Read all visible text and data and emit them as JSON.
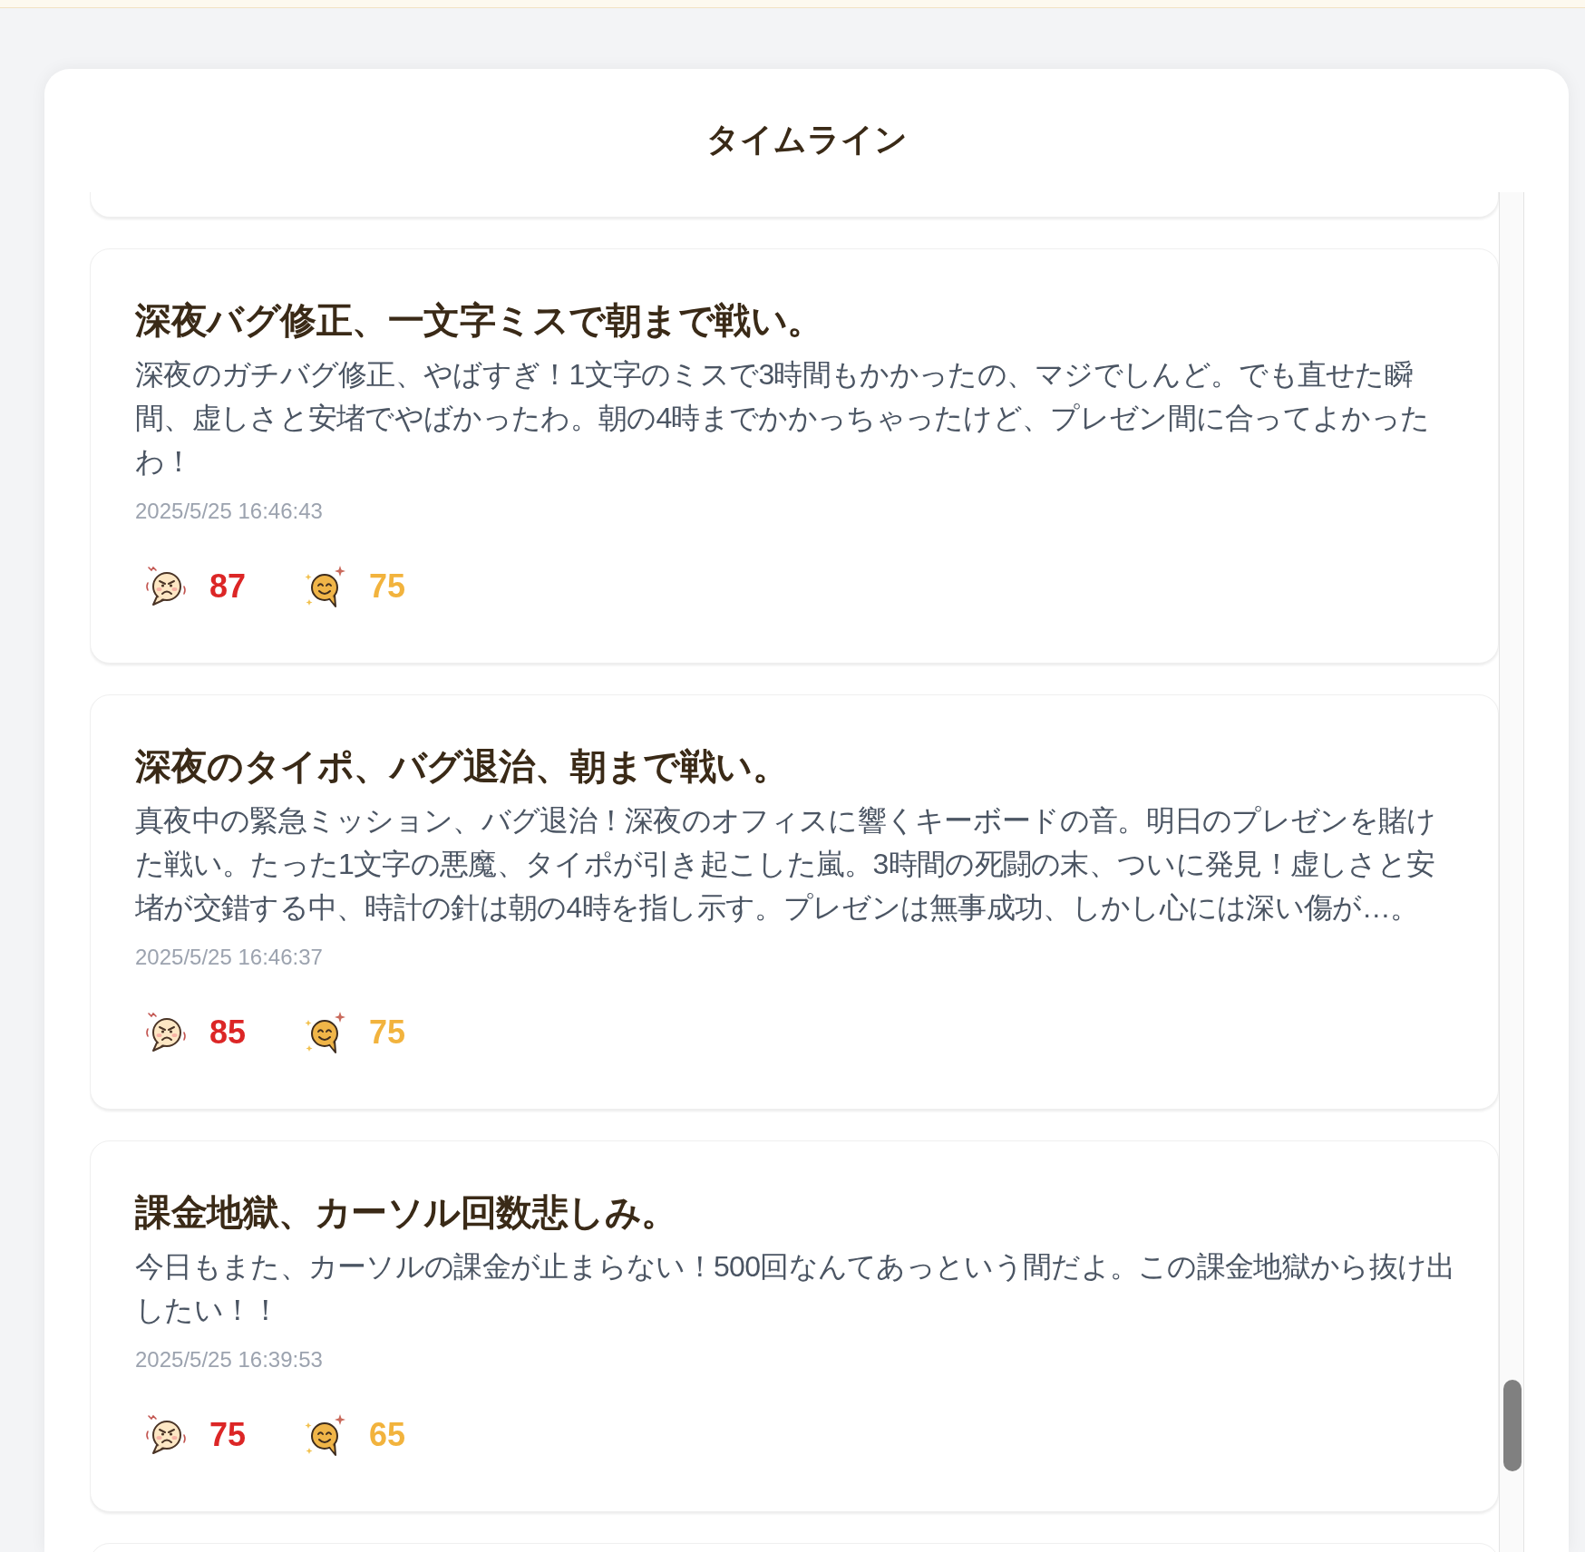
{
  "header": {
    "title": "タイムライン"
  },
  "posts": [
    {
      "title": "深夜バグ修正、一文字ミスで朝まで戦い。",
      "body": "深夜のガチバグ修正、やばすぎ！1文字のミスで3時間もかかったの、マジでしんど。でも直せた瞬間、虚しさと安堵でやばかったわ。朝の4時までかかっちゃったけど、プレゼン間に合ってよかったわ！",
      "timestamp": "2025/5/25 16:46:43",
      "reactions": [
        {
          "kind": "angry",
          "count": "87"
        },
        {
          "kind": "smile",
          "count": "75"
        }
      ]
    },
    {
      "title": "深夜のタイポ、バグ退治、朝まで戦い。",
      "body": "真夜中の緊急ミッション、バグ退治！深夜のオフィスに響くキーボードの音。明日のプレゼンを賭けた戦い。たった1文字の悪魔、タイポが引き起こした嵐。3時間の死闘の末、ついに発見！虚しさと安堵が交錯する中、時計の針は朝の4時を指し示す。プレゼンは無事成功、しかし心には深い傷が…。",
      "timestamp": "2025/5/25 16:46:37",
      "reactions": [
        {
          "kind": "angry",
          "count": "85"
        },
        {
          "kind": "smile",
          "count": "75"
        }
      ]
    },
    {
      "title": "課金地獄、カーソル回数悲しみ。",
      "body": "今日もまた、カーソルの課金が止まらない！500回なんてあっという間だよ。この課金地獄から抜け出したい！！",
      "timestamp": "2025/5/25 16:39:53",
      "reactions": [
        {
          "kind": "angry",
          "count": "75"
        },
        {
          "kind": "smile",
          "count": "65"
        }
      ]
    }
  ]
}
